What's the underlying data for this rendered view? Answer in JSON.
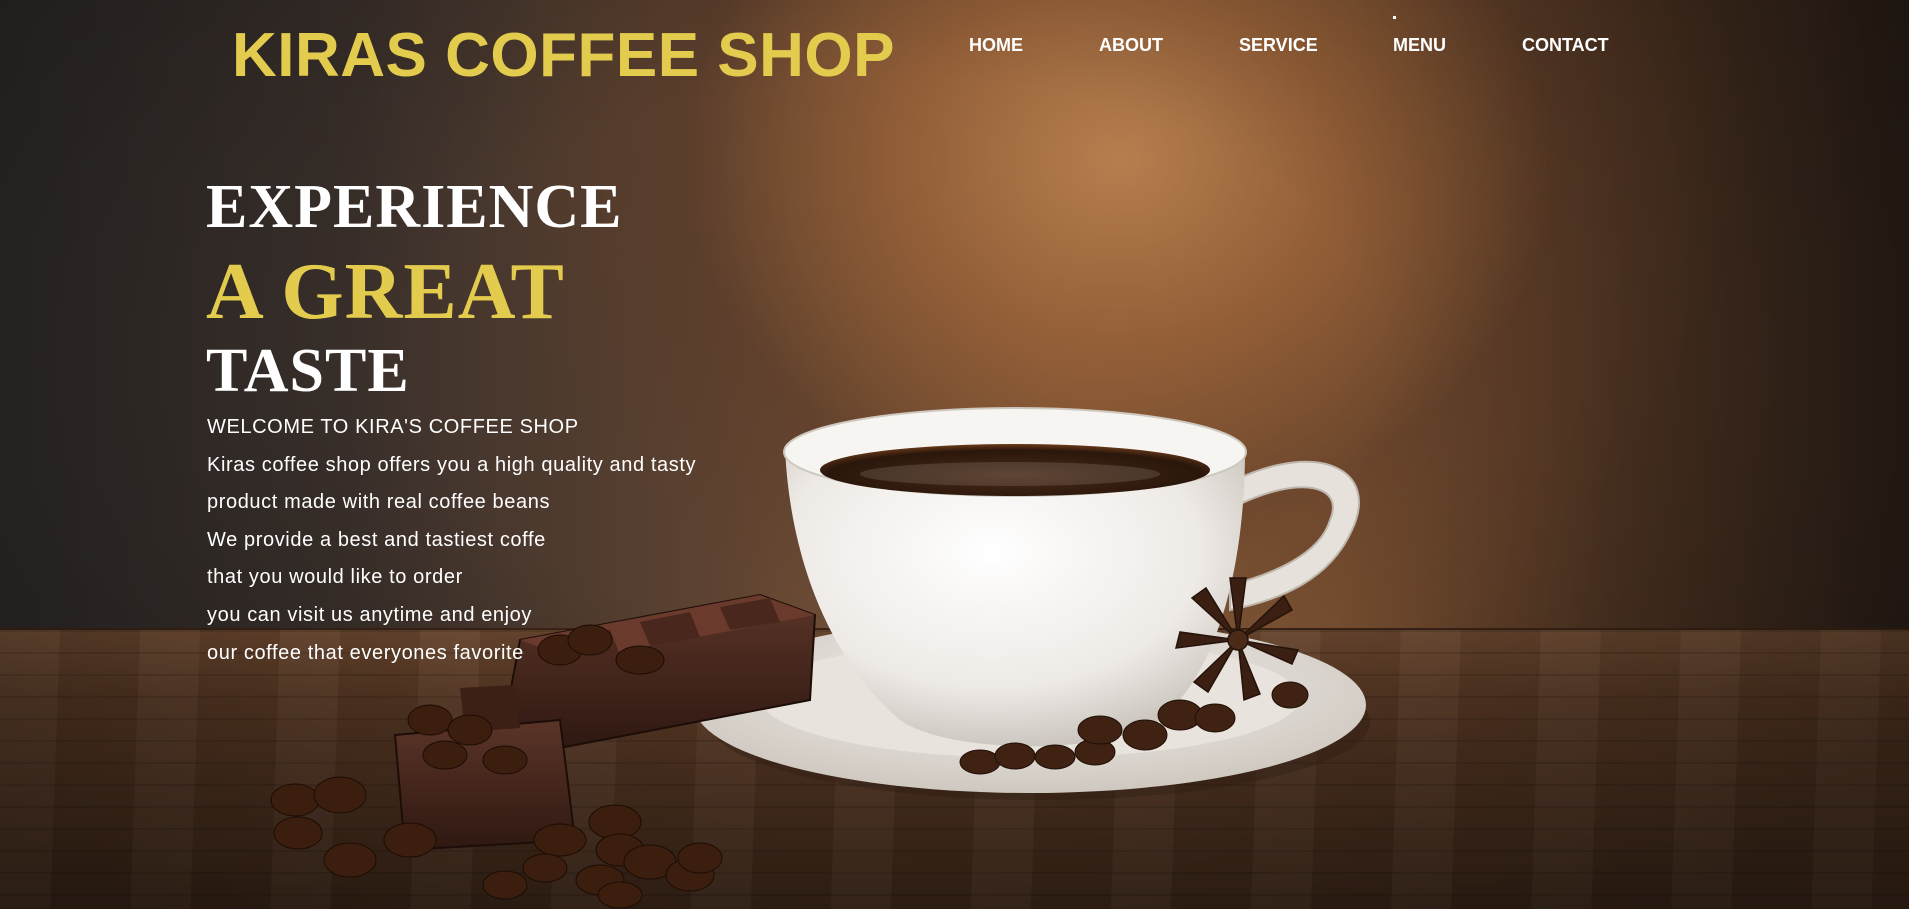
{
  "header": {
    "logo": "KIRAS COFFEE SHOP",
    "nav": [
      "HOME",
      "ABOUT",
      "SERVICE",
      "MENU",
      "CONTACT"
    ]
  },
  "hero": {
    "headline_line1": "EXPERIENCE",
    "headline_line2": "A GREAT",
    "headline_line3": "TASTE",
    "welcome": "WELCOME TO KIRA'S COFFEE SHOP",
    "description": [
      "Kiras coffee shop offers you a high quality and tasty",
      "product made with real coffee beans",
      "We provide a best and tastiest coffe",
      "that you would like to order",
      "you can visit us anytime and enjoy",
      "our coffee that everyones favorite"
    ]
  },
  "colors": {
    "accent": "#e3cb4d",
    "text": "#ffffff"
  }
}
